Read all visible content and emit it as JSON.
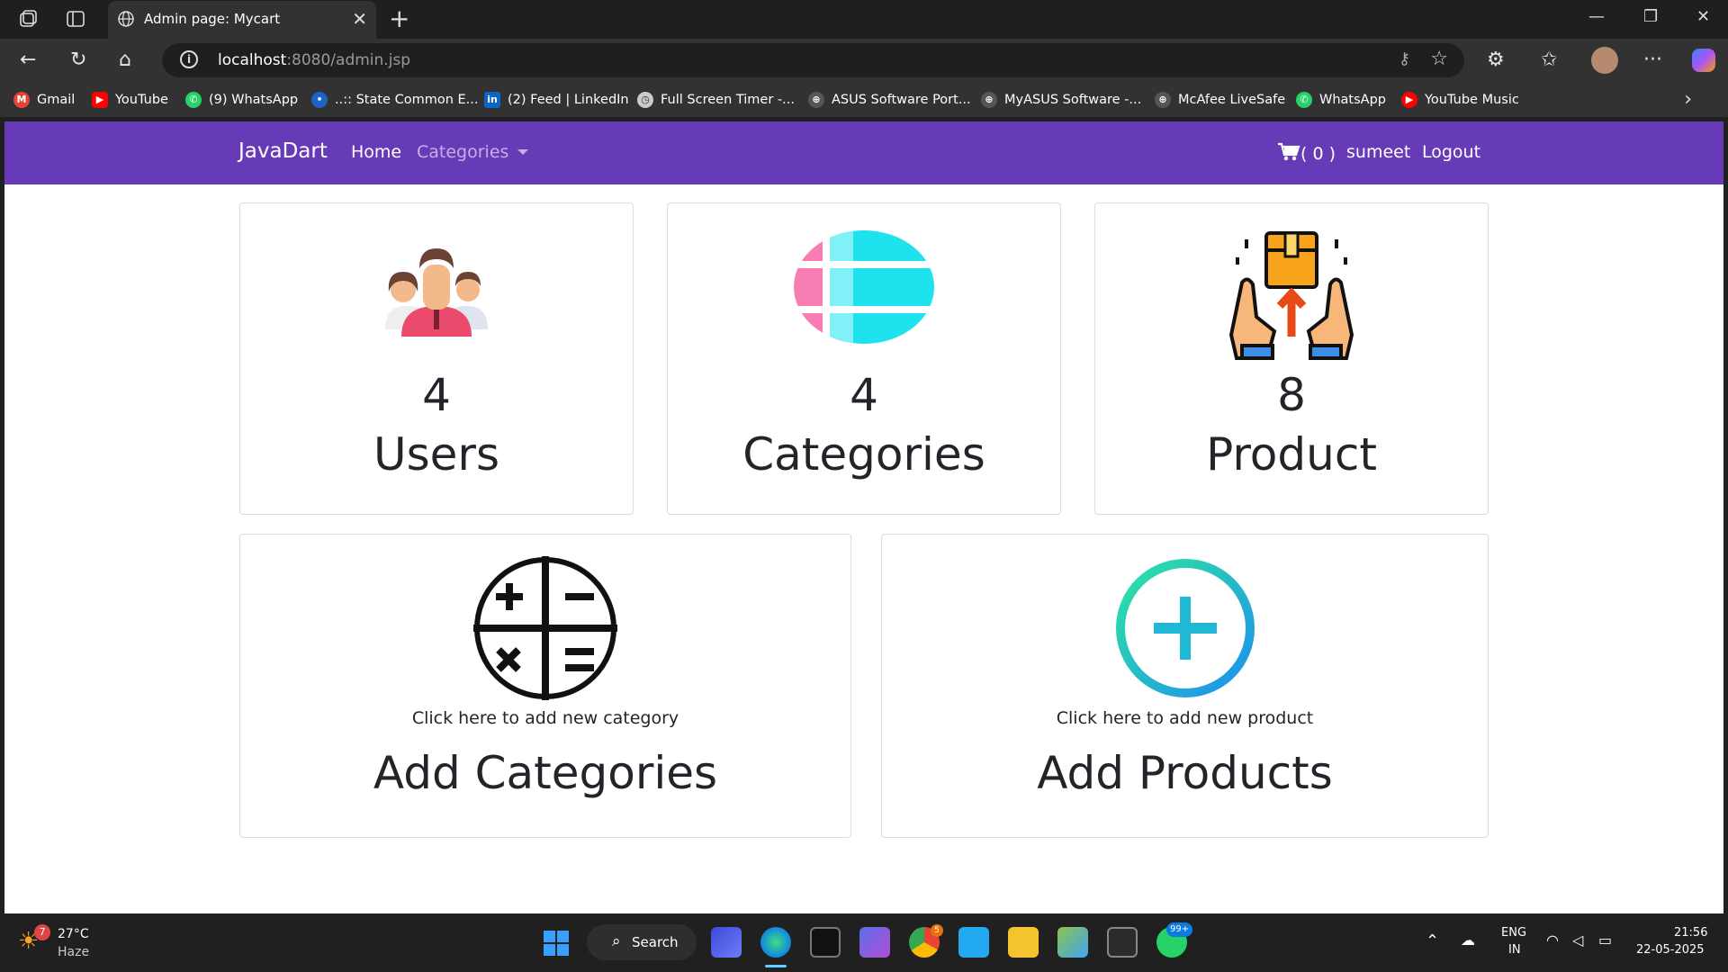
{
  "browser": {
    "tab_title": "Admin page: Mycart",
    "url_host": "localhost",
    "url_path": ":8080/admin.jsp",
    "bookmarks": [
      {
        "label": "Gmail",
        "color": "#ea4335",
        "glyph": "M"
      },
      {
        "label": "YouTube",
        "color": "#ff0000",
        "glyph": "▶"
      },
      {
        "label": "(9) WhatsApp",
        "color": "#25d366",
        "glyph": "✆"
      },
      {
        "label": "..:: State Common E...",
        "color": "#1e63c6",
        "glyph": "•"
      },
      {
        "label": "(2) Feed | LinkedIn",
        "color": "#0a66c2",
        "glyph": "in"
      },
      {
        "label": "Full Screen Timer -...",
        "color": "#cccccc",
        "glyph": "◷"
      },
      {
        "label": "ASUS Software Port...",
        "color": "#555555",
        "glyph": "⊕"
      },
      {
        "label": "MyASUS Software -...",
        "color": "#555555",
        "glyph": "⊕"
      },
      {
        "label": "McAfee LiveSafe",
        "color": "#555555",
        "glyph": "⊕"
      },
      {
        "label": "WhatsApp",
        "color": "#25d366",
        "glyph": "✆"
      },
      {
        "label": "YouTube Music",
        "color": "#ff0000",
        "glyph": "▶"
      }
    ]
  },
  "navbar": {
    "brand": "JavaDart",
    "home": "Home",
    "categories": "Categories",
    "cart": "( 0 )",
    "user": "sumeet",
    "logout": "Logout"
  },
  "stats": {
    "users": {
      "count": "4",
      "label": "Users"
    },
    "categories": {
      "count": "4",
      "label": "Categories"
    },
    "products": {
      "count": "8",
      "label": "Product"
    }
  },
  "actions": {
    "add_category": {
      "hint": "Click here to add new category",
      "label": "Add Categories"
    },
    "add_product": {
      "hint": "Click here to add new product",
      "label": "Add Products"
    }
  },
  "taskbar": {
    "weather_temp": "27°C",
    "weather_desc": "Haze",
    "weather_badge": "7",
    "search": "Search",
    "lang_top": "ENG",
    "lang_bottom": "IN",
    "time": "21:56",
    "date": "22-05-2025",
    "whatsapp_badge": "99+",
    "chrome_badge": "5"
  },
  "colors": {
    "navbar": "#673ab7",
    "browser_chrome": "#323232"
  }
}
